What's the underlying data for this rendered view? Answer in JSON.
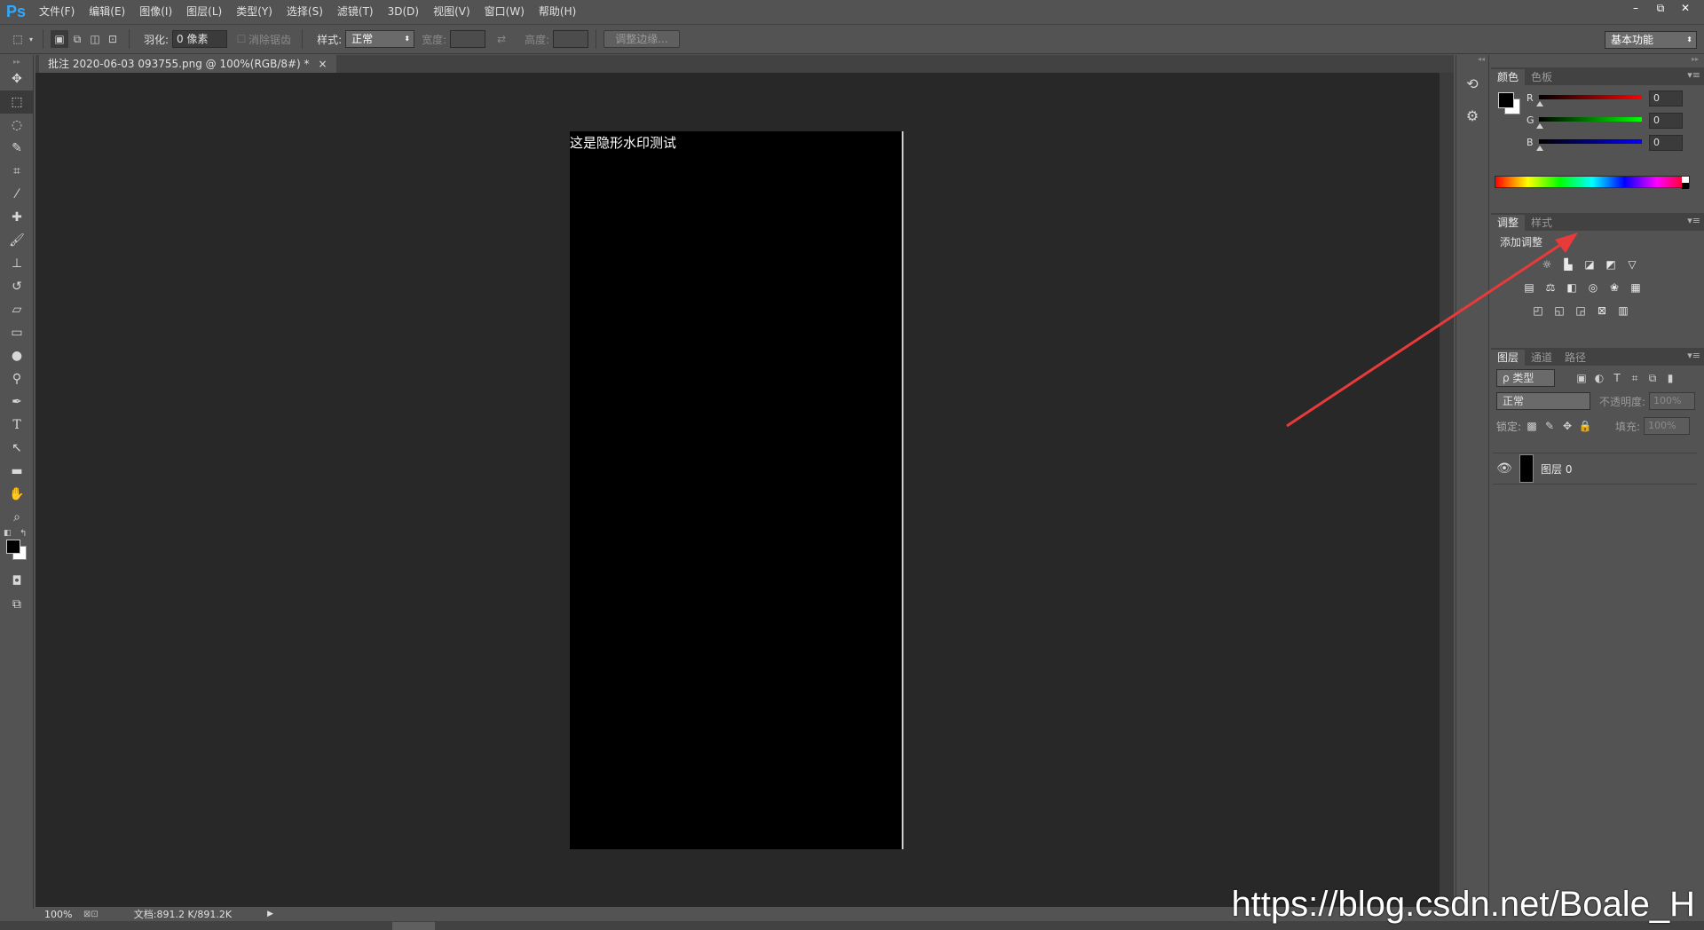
{
  "app": {
    "logo": "Ps",
    "menu": [
      "文件(F)",
      "编辑(E)",
      "图像(I)",
      "图层(L)",
      "类型(Y)",
      "选择(S)",
      "滤镜(T)",
      "3D(D)",
      "视图(V)",
      "窗口(W)",
      "帮助(H)"
    ],
    "window_controls": {
      "minimize": "–",
      "restore": "⧉",
      "close": "✕"
    }
  },
  "options": {
    "feather_label": "羽化:",
    "feather_value": "0 像素",
    "antialias_label": "消除锯齿",
    "style_label": "样式:",
    "style_value": "正常",
    "width_label": "宽度:",
    "height_label": "高度:",
    "refine_edge": "调整边缘...",
    "workspace": "基本功能"
  },
  "document": {
    "tab_title": "批注 2020-06-03 093755.png @ 100%(RGB/8#) *",
    "tab_close": "×",
    "canvas_text": "这是隐形水印测试"
  },
  "status": {
    "zoom": "100%",
    "doc_info": "文档:891.2 K/891.2K",
    "arrow": "▶"
  },
  "panels": {
    "color": {
      "tabs": [
        "颜色",
        "色板"
      ],
      "r_label": "R",
      "r_value": "0",
      "g_label": "G",
      "g_value": "0",
      "b_label": "B",
      "b_value": "0"
    },
    "adjustments": {
      "tabs": [
        "调整",
        "样式"
      ],
      "title": "添加调整"
    },
    "layers": {
      "tabs": [
        "图层",
        "通道",
        "路径"
      ],
      "filter_kind": "ρ 类型",
      "blend_mode": "正常",
      "opacity_label": "不透明度:",
      "opacity_value": "100%",
      "lock_label": "锁定:",
      "fill_label": "填充:",
      "fill_value": "100%",
      "layer_name": "图层 0"
    },
    "menu_glyph": "▾≡"
  },
  "watermark": "https://blog.csdn.net/Boale_H",
  "colors": {
    "annotation_arrow": "#e83a3a",
    "ps_blue": "#31a8ff"
  }
}
